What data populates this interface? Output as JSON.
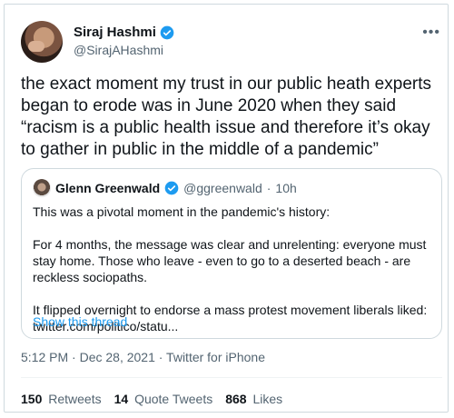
{
  "author": {
    "display_name": "Siraj Hashmi",
    "handle": "@SirajAHashmi",
    "verified": true
  },
  "more_label": "•••",
  "tweet_text": "the exact moment my trust in our public heath experts began to erode was in June 2020 when they said “racism is a public health issue and therefore it’s okay to gather in public in the middle of a pandemic”",
  "quoted": {
    "display_name": "Glenn Greenwald",
    "handle": "@ggreenwald",
    "separator": "·",
    "time": "10h",
    "paragraphs": [
      "This was a pivotal moment in the pandemic's history:",
      "For 4 months, the message was clear and unrelenting: everyone must stay home. Those who leave - even to go to a deserted beach - are reckless sociopaths.",
      "It flipped overnight to endorse a mass protest movement liberals liked: twitter.com/politico/statu..."
    ],
    "show_thread": "Show this thread"
  },
  "timestamp": "5:12 PM · Dec 28, 2021 · Twitter for iPhone",
  "stats": {
    "retweets_count": "150",
    "retweets_label": "Retweets",
    "quotes_count": "14",
    "quotes_label": "Quote Tweets",
    "likes_count": "868",
    "likes_label": "Likes"
  },
  "colors": {
    "accent": "#1d9bf0",
    "secondary_text": "#536471",
    "border": "#cfd9de"
  },
  "icons": {
    "verified": "verified-badge-icon",
    "more": "more-options-icon"
  }
}
